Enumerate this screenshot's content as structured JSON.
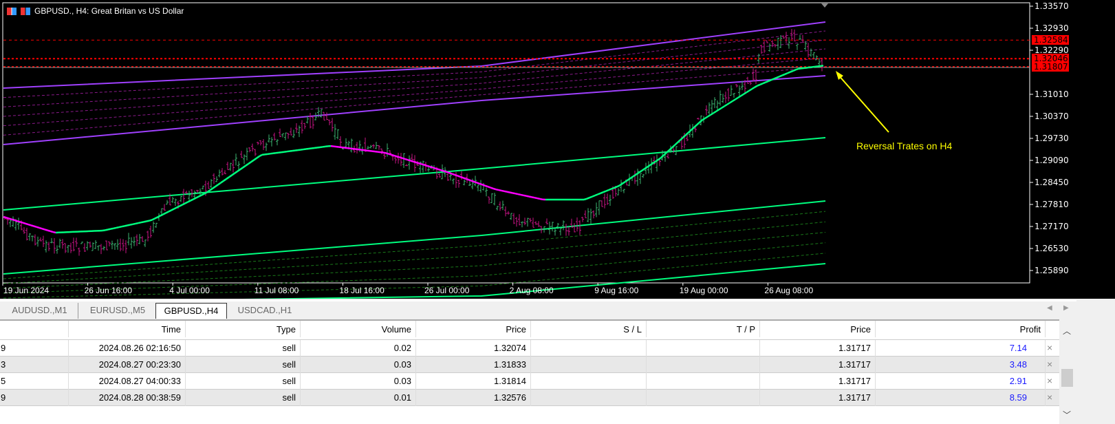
{
  "chart": {
    "symbol_title": "GBPUSD., H4:  Great Britan vs US Dollar",
    "price_axis": [
      "1.33570",
      "1.32930",
      "1.32290",
      "1.31010",
      "1.30370",
      "1.29730",
      "1.29090",
      "1.28450",
      "1.27810",
      "1.27170",
      "1.26530",
      "1.25890"
    ],
    "price_axis_values": [
      1.3357,
      1.3293,
      1.3229,
      1.3101,
      1.3037,
      1.2973,
      1.2909,
      1.2845,
      1.2781,
      1.2717,
      1.2653,
      1.2589
    ],
    "order_levels": [
      {
        "label": "1.32584",
        "value": 1.32584
      },
      {
        "label": "1.32046",
        "value": 1.32046
      },
      {
        "label": "1.31807",
        "value": 1.31807
      }
    ],
    "time_axis": [
      "19 Jun 2024",
      "26 Jun 16:00",
      "4 Jul 00:00",
      "11 Jul 08:00",
      "18 Jul 16:00",
      "26 Jul 00:00",
      "2 Aug 08:00",
      "9 Aug 16:00",
      "19 Aug 00:00",
      "26 Aug 08:00"
    ],
    "annotation": "Reversal Trates on H4",
    "colors": {
      "level": "#ff0000",
      "ma_up": "#00ff7f",
      "ma_down": "#ff00ff",
      "band_upper": "#a040ff",
      "band_lower": "#00e676",
      "annotation": "#ffff00"
    }
  },
  "tabs": [
    "AUDUSD.,M1",
    "EURUSD.,M5",
    "GBPUSD.,H4",
    "USDCAD.,H1"
  ],
  "active_tab": "GBPUSD.,H4",
  "table": {
    "headers": [
      "",
      "Time",
      "Type",
      "Volume",
      "Price",
      "S / L",
      "T / P",
      "Price",
      "Profit"
    ],
    "rows": [
      [
        "9",
        "2024.08.26 02:16:50",
        "sell",
        "0.02",
        "1.32074",
        "",
        "",
        "1.31717",
        "7.14"
      ],
      [
        "3",
        "2024.08.27 00:23:30",
        "sell",
        "0.03",
        "1.31833",
        "",
        "",
        "1.31717",
        "3.48"
      ],
      [
        "5",
        "2024.08.27 04:00:33",
        "sell",
        "0.03",
        "1.31814",
        "",
        "",
        "1.31717",
        "2.91"
      ],
      [
        "9",
        "2024.08.28 00:38:59",
        "sell",
        "0.01",
        "1.32576",
        "",
        "",
        "1.31717",
        "8.59"
      ]
    ],
    "close_icon": "×"
  }
}
